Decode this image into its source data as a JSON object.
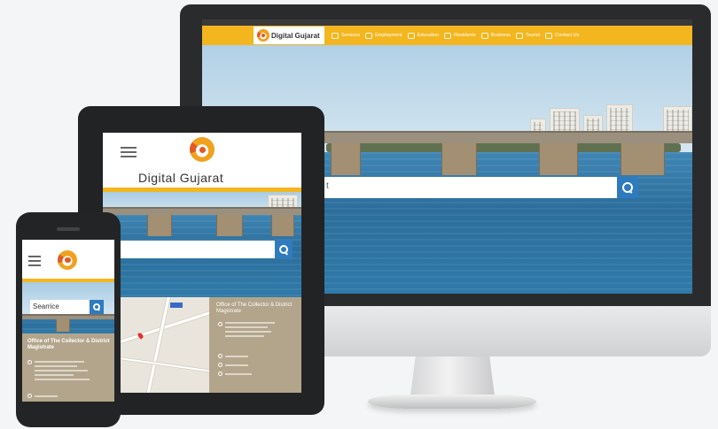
{
  "monitor": {
    "topbar_text": "",
    "brand": "Digital Gujarat",
    "menu": [
      "Services",
      "Employment",
      "Education",
      "Residents",
      "Business",
      "Tourist",
      "Contact Us"
    ],
    "search_text": "t"
  },
  "tablet": {
    "brand": "Digital Gujarat",
    "office_title": "Office of The Collector & District Magistrate"
  },
  "phone": {
    "search_text": "Searrice",
    "office_title": "Office of The Collector & District Magistrate"
  },
  "colors": {
    "accent_yellow": "#f3b61f",
    "search_blue": "#2e7bbf",
    "footer_khaki": "#b3a58b"
  }
}
